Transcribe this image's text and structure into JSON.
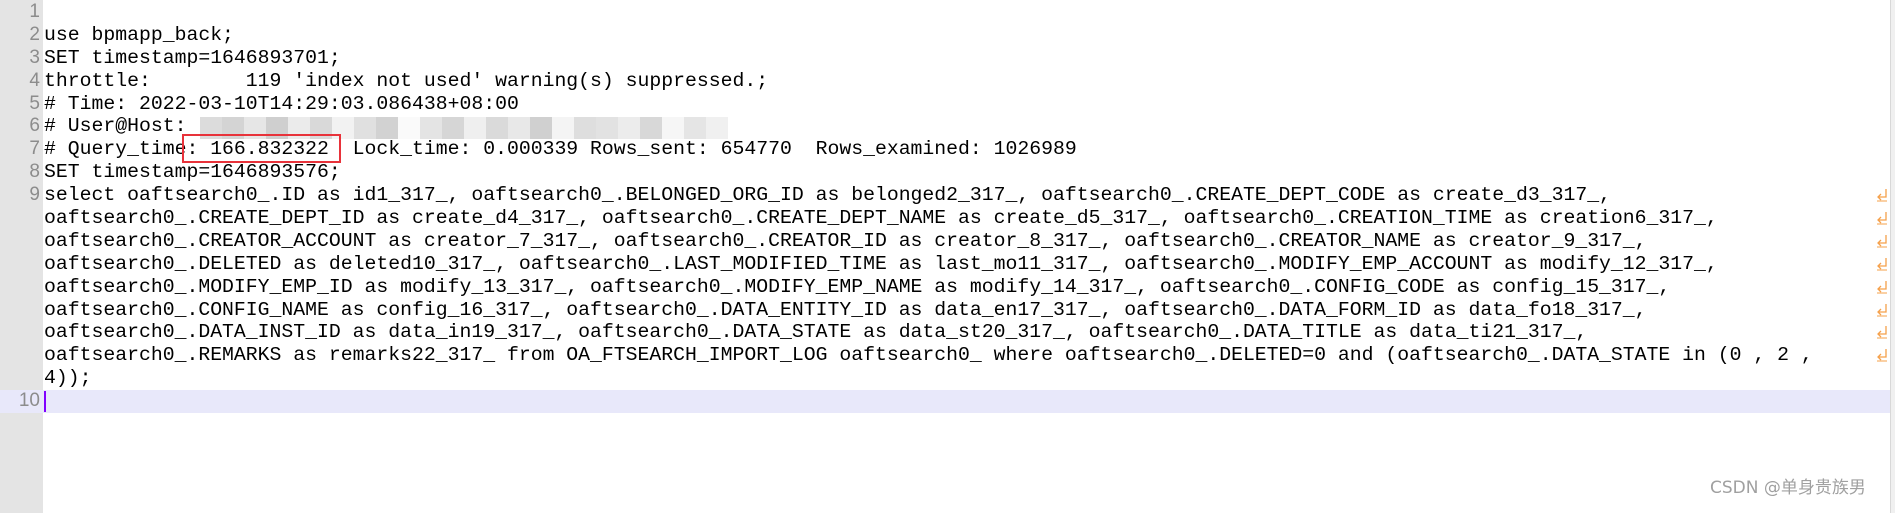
{
  "colors": {
    "gutter": "#e4e4e4",
    "current_line": "#e8e8fa",
    "highlight_box": "#e8323a",
    "wrap_icon": "#f5a04a"
  },
  "lines": [
    {
      "num": "1",
      "rows": [
        ""
      ]
    },
    {
      "num": "2",
      "rows": [
        "use bpmapp_back;"
      ]
    },
    {
      "num": "3",
      "rows": [
        "SET timestamp=1646893701;"
      ]
    },
    {
      "num": "4",
      "rows": [
        "throttle:        119 'index not used' warning(s) suppressed.;"
      ]
    },
    {
      "num": "5",
      "rows": [
        "# Time: 2022-03-10T14:29:03.086438+08:00"
      ]
    },
    {
      "num": "6",
      "rows": [
        "# User@Host: "
      ]
    },
    {
      "num": "7",
      "rows": [
        "# Query_time: 166.832322  Lock_time: 0.000339 Rows_sent: 654770  Rows_examined: 1026989"
      ]
    },
    {
      "num": "8",
      "rows": [
        "SET timestamp=1646893576;"
      ]
    },
    {
      "num": "9",
      "rows": [
        "select oaftsearch0_.ID as id1_317_, oaftsearch0_.BELONGED_ORG_ID as belonged2_317_, oaftsearch0_.CREATE_DEPT_CODE as create_d3_317_,",
        "oaftsearch0_.CREATE_DEPT_ID as create_d4_317_, oaftsearch0_.CREATE_DEPT_NAME as create_d5_317_, oaftsearch0_.CREATION_TIME as creation6_317_,",
        "oaftsearch0_.CREATOR_ACCOUNT as creator_7_317_, oaftsearch0_.CREATOR_ID as creator_8_317_, oaftsearch0_.CREATOR_NAME as creator_9_317_,",
        "oaftsearch0_.DELETED as deleted10_317_, oaftsearch0_.LAST_MODIFIED_TIME as last_mo11_317_, oaftsearch0_.MODIFY_EMP_ACCOUNT as modify_12_317_,",
        "oaftsearch0_.MODIFY_EMP_ID as modify_13_317_, oaftsearch0_.MODIFY_EMP_NAME as modify_14_317_, oaftsearch0_.CONFIG_CODE as config_15_317_,",
        "oaftsearch0_.CONFIG_NAME as config_16_317_, oaftsearch0_.DATA_ENTITY_ID as data_en17_317_, oaftsearch0_.DATA_FORM_ID as data_fo18_317_,",
        "oaftsearch0_.DATA_INST_ID as data_in19_317_, oaftsearch0_.DATA_STATE as data_st20_317_, oaftsearch0_.DATA_TITLE as data_ti21_317_,",
        "oaftsearch0_.REMARKS as remarks22_317_ from OA_FTSEARCH_IMPORT_LOG oaftsearch0_ where oaftsearch0_.DELETED=0 and (oaftsearch0_.DATA_STATE in (0 , 2 ,",
        "4));"
      ]
    },
    {
      "num": "10",
      "rows": [
        ""
      ],
      "current": true
    }
  ],
  "watermark": "CSDN @单身贵族男"
}
